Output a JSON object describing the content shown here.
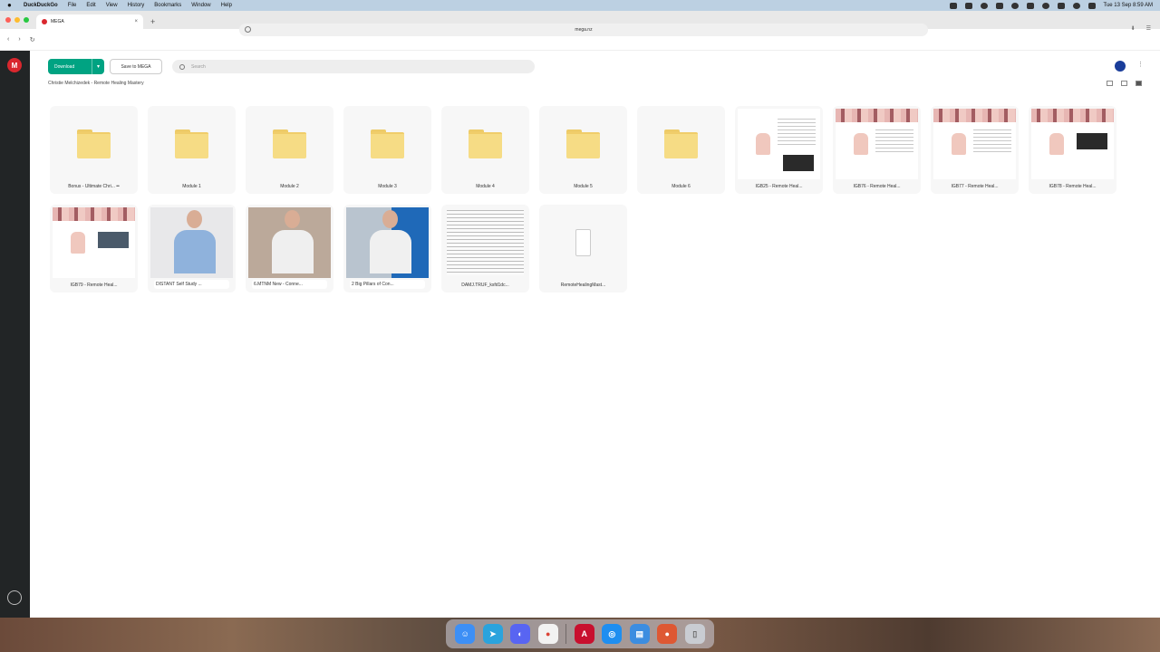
{
  "menubar": {
    "app_name": "DuckDuckGo",
    "items": [
      "File",
      "Edit",
      "View",
      "History",
      "Bookmarks",
      "Window",
      "Help"
    ],
    "clock": "Tue 13 Sep 8:59 AM"
  },
  "browser": {
    "tab_title": "MEGA",
    "new_tab": "+",
    "url": "mega.nz",
    "nav_back": "‹",
    "nav_forward": "›",
    "nav_reload": "↻",
    "download_icon": "download-icon",
    "menu_icon": "menu-icon"
  },
  "mega": {
    "logo": "M",
    "download_label": "Download",
    "save_label": "Save to MEGA",
    "search_placeholder": "Search",
    "breadcrumb": "Christie Melchizedek - Remote Healing Mastery",
    "kebab": "⋮",
    "items": [
      {
        "type": "folder",
        "name": "Bonus - Ultimate Chri... ••"
      },
      {
        "type": "folder",
        "name": "Module 1"
      },
      {
        "type": "folder",
        "name": "Module 2"
      },
      {
        "type": "folder",
        "name": "Module 3"
      },
      {
        "type": "folder",
        "name": "Module 4"
      },
      {
        "type": "folder",
        "name": "Module 5"
      },
      {
        "type": "folder",
        "name": "Module 6"
      },
      {
        "type": "image",
        "name": "IGB25 - Remote Heal..."
      },
      {
        "type": "image",
        "name": "IGB76 - Remote Heal..."
      },
      {
        "type": "image",
        "name": "IGB77 - Remote Heal..."
      },
      {
        "type": "image",
        "name": "IGB78 - Remote Heal..."
      },
      {
        "type": "image",
        "name": "IGB79 - Remote Heal..."
      },
      {
        "type": "video",
        "name": "DISTANT Self Study ..."
      },
      {
        "type": "video",
        "name": "6.MTNM New - Conne..."
      },
      {
        "type": "video",
        "name": "2 Big Pillars of Con..."
      },
      {
        "type": "doc",
        "name": "DAMJ.TRUF_ksfd1dc..."
      },
      {
        "type": "file",
        "name": "RemoteHealingMast..."
      }
    ]
  },
  "colors": {
    "mega_red": "#d9272e",
    "download_green": "#00a382",
    "sidebar": "#222526",
    "folder_yellow": "#f6dc85"
  },
  "dock": [
    "Finder",
    "Telegram",
    "Discord",
    "Chrome",
    "Acrobat",
    "Safari",
    "Preview",
    "DuckDuckGo",
    "Trash"
  ]
}
